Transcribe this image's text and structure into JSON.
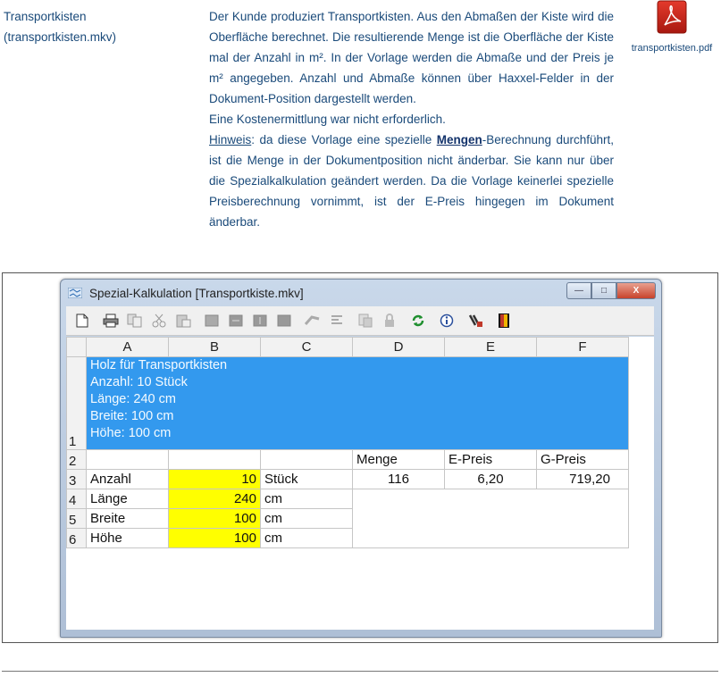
{
  "item": {
    "title": "Transportkisten",
    "file": "(transportkisten.mkv)"
  },
  "description": {
    "p1": "Der Kunde produziert Transportkisten. Aus den Abmaßen der Kiste wird die Oberfläche berechnet. Die resultierende Menge ist die Oberfläche der Kiste mal der Anzahl in m². In der Vorlage werden die Abmaße und der Preis je m² angegeben. Anzahl und Abmaße können über Haxxel-Felder in der Dokument-Position dargestellt werden.",
    "p2": "Eine Kostenermittlung war nicht erforderlich.",
    "hint_label": "Hinweis",
    "hint_a": ": da diese Vorlage eine spezielle ",
    "hint_bold": "Mengen",
    "hint_b": "-Berechnung durchführt, ist die Menge in der Dokumentposition nicht änderbar. Sie kann nur über die Spezialkalkulation geändert werden. Da die Vorlage keinerlei spezielle Preisberechnung vornimmt, ist der E-Preis hingegen im Dokument änderbar."
  },
  "attachment": {
    "icon": "pdf-icon",
    "name": "transportkisten.pdf"
  },
  "window": {
    "title": "Spezial-Kalkulation [Transportkiste.mkv]",
    "buttons": [
      "minimize",
      "maximize",
      "close"
    ]
  },
  "toolbar_icons": [
    "new-icon",
    "print-icon",
    "copy-icon",
    "cut-icon",
    "paste-icon",
    "row-insert-icon",
    "row-append-icon",
    "row-delete-icon",
    "row-clear-icon",
    "column-icon",
    "align-icon",
    "format-icon",
    "lock-icon",
    "refresh-icon",
    "info-icon",
    "settings-icon",
    "exit-icon"
  ],
  "sheet": {
    "columns": [
      "A",
      "B",
      "C",
      "D",
      "E",
      "F"
    ],
    "rows": [
      "1",
      "2",
      "3",
      "4",
      "5",
      "6"
    ],
    "blue_lines": [
      "Holz für Transportkisten",
      "Anzahl: 10 Stück",
      "Länge: 240 cm",
      "Breite: 100 cm",
      "Höhe: 100 cm"
    ],
    "headers": {
      "menge": "Menge",
      "epreis": "E-Preis",
      "gpreis": "G-Preis"
    },
    "values": {
      "menge": "116",
      "epreis": "6,20",
      "gpreis": "719,20"
    },
    "inputs": [
      {
        "label": "Anzahl",
        "value": "10",
        "unit": "Stück"
      },
      {
        "label": "Länge",
        "value": "240",
        "unit": "cm"
      },
      {
        "label": "Breite",
        "value": "100",
        "unit": "cm"
      },
      {
        "label": "Höhe",
        "value": "100",
        "unit": "cm"
      }
    ]
  },
  "colors": {
    "selection_blue": "#3399ee",
    "input_yellow": "#ffff00",
    "text_blue": "#1a4a7a"
  }
}
